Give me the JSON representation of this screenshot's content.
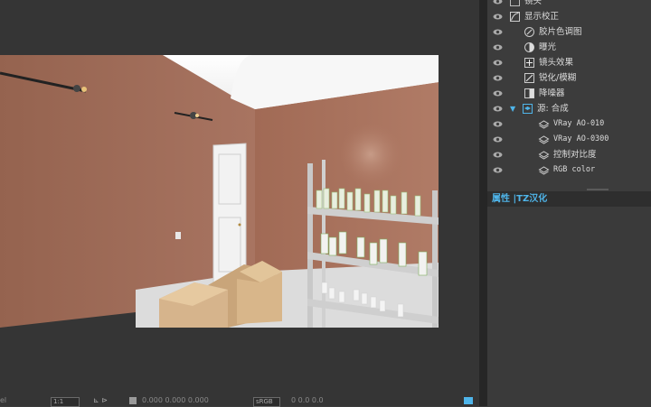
{
  "layers": [
    {
      "label": "镜头",
      "indent": 1,
      "icon": "square-icon",
      "mono": false,
      "expanded": false
    },
    {
      "label": "显示校正",
      "indent": 1,
      "icon": "curve-icon",
      "mono": false,
      "expanded": false
    },
    {
      "label": "胶片色调图",
      "indent": 2,
      "icon": "filmic-icon",
      "mono": false,
      "expanded": false
    },
    {
      "label": "曝光",
      "indent": 2,
      "icon": "exposure-icon",
      "mono": false,
      "expanded": false
    },
    {
      "label": "镜头效果",
      "indent": 2,
      "icon": "lens-effects-icon",
      "mono": false,
      "expanded": false
    },
    {
      "label": "锐化/模糊",
      "indent": 2,
      "icon": "sharpen-icon",
      "mono": false,
      "expanded": false
    },
    {
      "label": "降噪器",
      "indent": 2,
      "icon": "denoiser-icon",
      "mono": false,
      "expanded": false
    },
    {
      "label": "源: 合成",
      "indent": 1,
      "icon": "layers-icon",
      "mono": false,
      "expanded": true
    },
    {
      "label": "VRay AO-010",
      "indent": 3,
      "icon": "layer-stack-icon",
      "mono": true,
      "expanded": false
    },
    {
      "label": "VRay AO-0300",
      "indent": 3,
      "icon": "layer-stack-icon",
      "mono": true,
      "expanded": false
    },
    {
      "label": "控制对比度",
      "indent": 3,
      "icon": "layer-stack-icon",
      "mono": false,
      "expanded": false
    },
    {
      "label": "RGB color",
      "indent": 3,
      "icon": "layer-stack-icon",
      "mono": true,
      "expanded": false
    }
  ],
  "properties_tab": "属性 |TZ汉化",
  "bottom_bar": {
    "zoom": "1:1",
    "coords": "0.000  0.000  0.000",
    "color_space": "sRGB",
    "values": "0   0.0   0.0"
  },
  "colors": {
    "accent": "#4fb5ea",
    "panel_bg": "#3c3c3c",
    "viewport_bg": "#353535",
    "wall": "#a06a55"
  }
}
